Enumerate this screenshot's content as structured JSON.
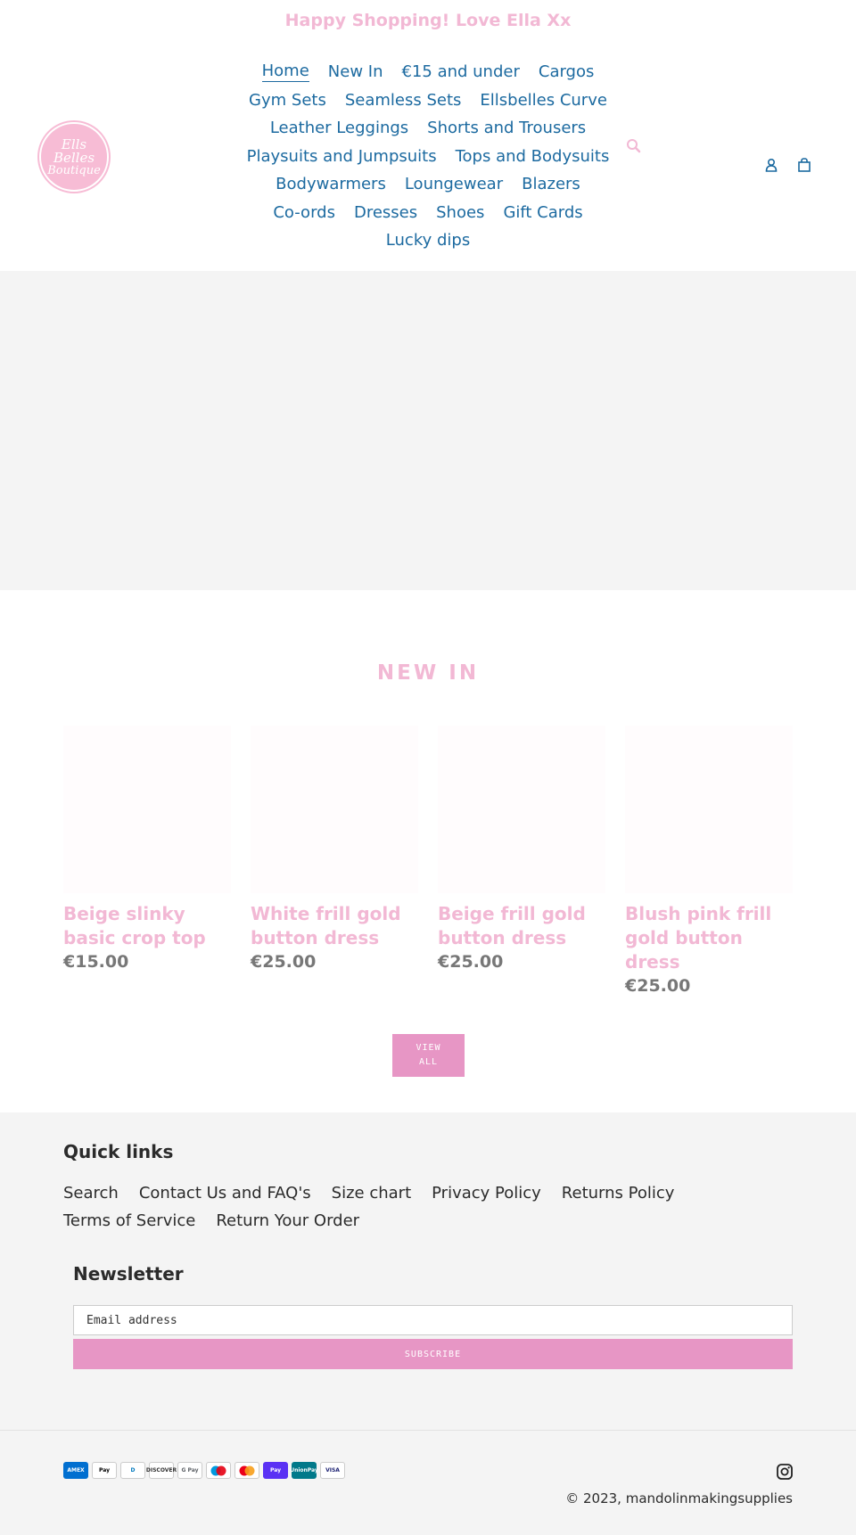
{
  "announcement": "Happy Shopping! Love Ella Xx",
  "logo": {
    "line1": "Ells",
    "line2": "Belles",
    "line3": "Boutique"
  },
  "nav": {
    "rows": [
      [
        "Home",
        "New In",
        "€15 and under",
        "Cargos"
      ],
      [
        "Gym Sets",
        "Seamless Sets",
        "Ellsbelles Curve"
      ],
      [
        "Leather Leggings",
        "Shorts and Trousers"
      ],
      [
        "Playsuits and Jumpsuits",
        "Tops and Bodysuits"
      ],
      [
        "Bodywarmers",
        "Loungewear",
        "Blazers"
      ],
      [
        "Co-ords",
        "Dresses",
        "Shoes",
        "Gift Cards"
      ],
      [
        "Lucky dips"
      ]
    ]
  },
  "header_icons": [
    "search-icon",
    "user-icon",
    "cart-icon"
  ],
  "featured": {
    "title": "NEW IN",
    "products": [
      {
        "name": "Beige slinky basic crop top",
        "price": "€15.00"
      },
      {
        "name": "White frill gold button dress",
        "price": "€25.00"
      },
      {
        "name": "Beige frill gold button dress",
        "price": "€25.00"
      },
      {
        "name": "Blush pink frill gold button dress",
        "price": "€25.00"
      }
    ],
    "view_all_line1": "VIEW",
    "view_all_line2": "ALL"
  },
  "footer": {
    "quick_links_title": "Quick links",
    "quick_links_rows": [
      [
        "Search",
        "Contact Us and FAQ's",
        "Size chart",
        "Privacy Policy",
        "Returns Policy"
      ],
      [
        "Terms of Service",
        "Return Your Order"
      ]
    ],
    "newsletter_title": "Newsletter",
    "email_placeholder": "Email address",
    "subscribe_label": "SUBSCRIBE",
    "payment_methods": [
      {
        "icon": "amex-icon",
        "label": "AMEX",
        "bg": "#016fd0",
        "fg": "#ffffff"
      },
      {
        "icon": "apple-pay-icon",
        "label": " Pay",
        "bg": "#ffffff",
        "fg": "#000000"
      },
      {
        "icon": "diners-club-icon",
        "label": "D",
        "bg": "#ffffff",
        "fg": "#0079be"
      },
      {
        "icon": "discover-icon",
        "label": "DISCOVER",
        "bg": "#ffffff",
        "fg": "#333333"
      },
      {
        "icon": "google-pay-icon",
        "label": "G Pay",
        "bg": "#ffffff",
        "fg": "#5f6368"
      },
      {
        "icon": "maestro-icon",
        "label": "",
        "bg": "#ffffff",
        "fg": "#000000"
      },
      {
        "icon": "mastercard-icon",
        "label": "",
        "bg": "#ffffff",
        "fg": "#000000"
      },
      {
        "icon": "shop-pay-icon",
        "label": "Pay",
        "bg": "#5a31f4",
        "fg": "#ffffff"
      },
      {
        "icon": "unionpay-icon",
        "label": "UnionPay",
        "bg": "#01798a",
        "fg": "#ffffff"
      },
      {
        "icon": "visa-icon",
        "label": "VISA",
        "bg": "#ffffff",
        "fg": "#1a1f71"
      }
    ],
    "copyright": "© 2023, mandolinmakingsupplies"
  },
  "colors": {
    "accent_pink": "#f2b8d4",
    "button_pink": "#e796c5",
    "link_blue": "#1c6aa0",
    "footer_bg": "#f4f4f4"
  }
}
